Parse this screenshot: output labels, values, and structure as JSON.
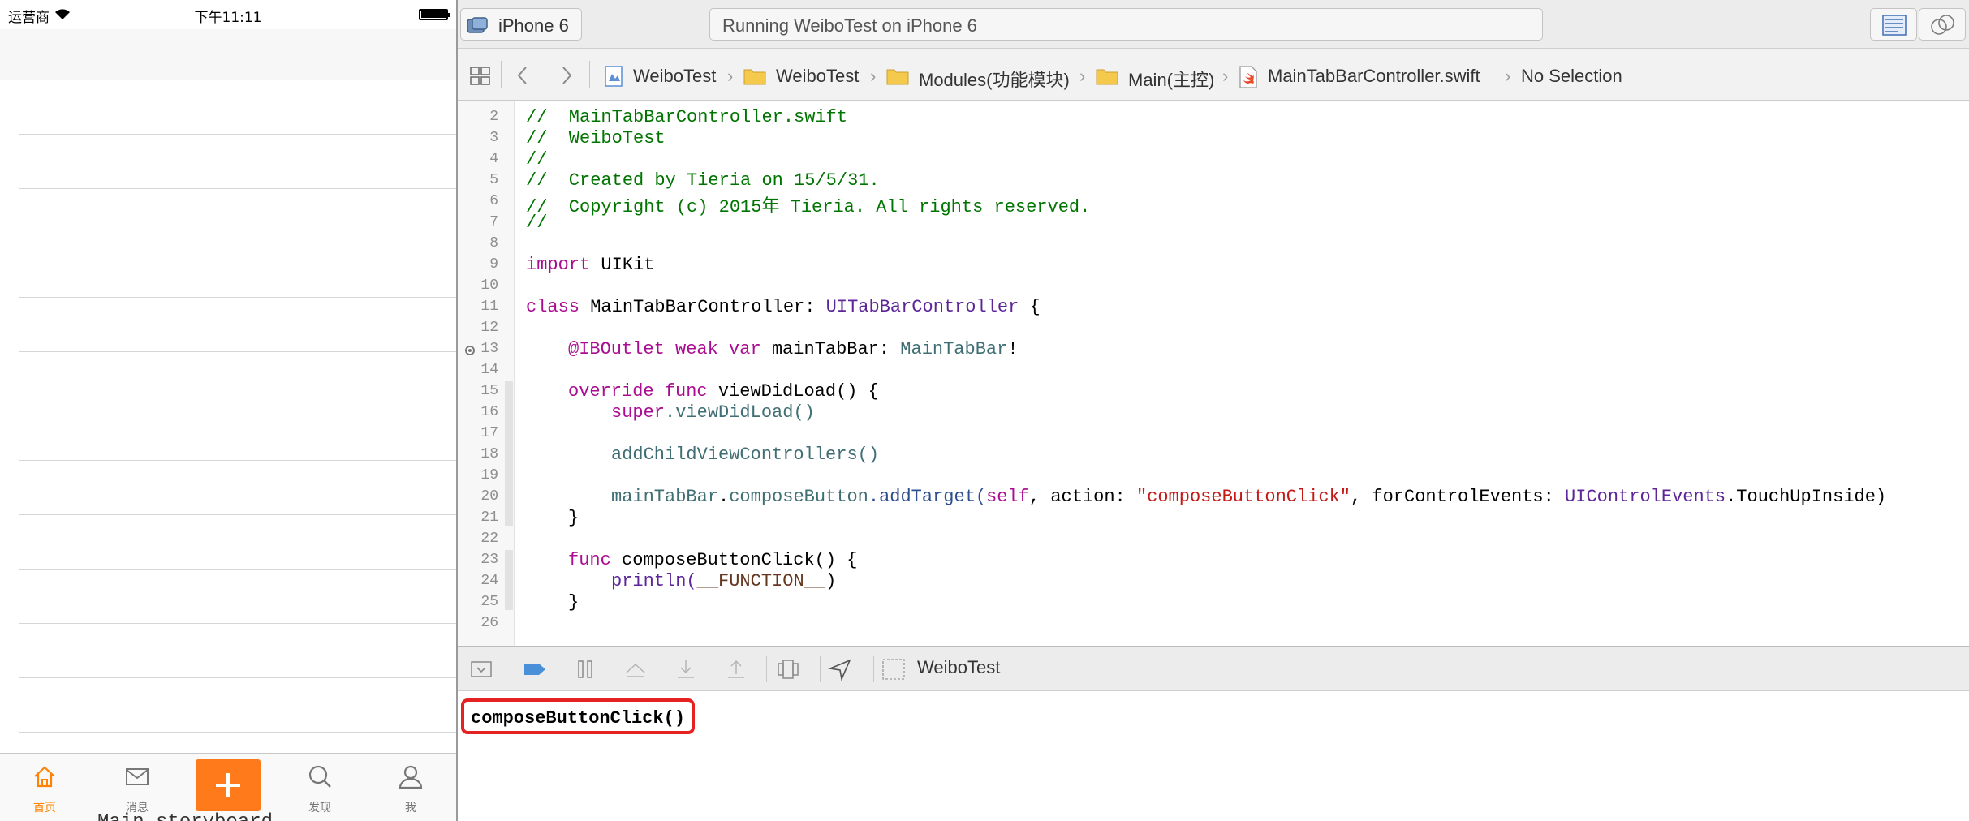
{
  "simulator": {
    "status_bar": {
      "carrier": "运营商",
      "time": "下午11:11"
    },
    "tab_bar": {
      "tabs": [
        {
          "label": "首页",
          "icon": "home-icon",
          "active": true
        },
        {
          "label": "消息",
          "icon": "envelope-icon",
          "active": false
        },
        {
          "label": "",
          "icon": "plus-icon",
          "active": false
        },
        {
          "label": "发现",
          "icon": "search-icon",
          "active": false
        },
        {
          "label": "我",
          "icon": "person-icon",
          "active": false
        }
      ],
      "active_color": "#ff8200",
      "compose_color": "#ff7a1a"
    },
    "clipped_text": "Main.storyboard"
  },
  "toolbar": {
    "scheme_device": "iPhone 6",
    "activity_status": "Running WeiboTest on iPhone 6"
  },
  "jumpbar": {
    "crumbs": [
      "WeiboTest",
      "WeiboTest",
      "Modules(功能模块)",
      "Main(主控)",
      "MainTabBarController.swift",
      "No Selection"
    ]
  },
  "editor": {
    "line_numbers": [
      "2",
      "3",
      "4",
      "5",
      "6",
      "7",
      "8",
      "9",
      "10",
      "11",
      "12",
      "13",
      "14",
      "15",
      "16",
      "17",
      "18",
      "19",
      "20",
      "21",
      "22",
      "23",
      "24",
      "25",
      "26"
    ],
    "lines": {
      "l2": "//  MainTabBarController.swift",
      "l3": "//  WeiboTest",
      "l4": "//",
      "l5": "//  Created by Tieria on 15/5/31.",
      "l6": "//  Copyright (c) 2015年 Tieria. All rights reserved.",
      "l7": "//",
      "l9_kw": "import",
      "l9_rest": " UIKit",
      "l11_kw": "class",
      "l11_name": " MainTabBarController: ",
      "l11_type": "UITabBarController",
      "l11_end": " {",
      "l13_attr": "@IBOutlet",
      "l13_kw": " weak var",
      "l13_name": " mainTabBar: ",
      "l13_type": "MainTabBar",
      "l13_end": "!",
      "l15_kw": "override func",
      "l15_rest": " viewDidLoad() {",
      "l16_kw": "super",
      "l16_rest": ".viewDidLoad()",
      "l18": "addChildViewControllers()",
      "l20_a": "mainTabBar",
      "l20_b": ".",
      "l20_c": "composeButton",
      "l20_d": ".addTarget(",
      "l20_self": "self",
      "l20_e": ", action: ",
      "l20_str": "\"composeButtonClick\"",
      "l20_f": ", forControlEvents: ",
      "l20_type": "UIControlEvents",
      "l20_g": ".TouchUpInside)",
      "l21": "}",
      "l23_kw": "func",
      "l23_rest": " composeButtonClick() {",
      "l24_fn": "println(",
      "l24_macro": "__FUNCTION__",
      "l24_end": ")",
      "l25": "}"
    },
    "colors": {
      "comment": "#007400",
      "keyword": "#aa0d91",
      "type": "#5c2699",
      "project": "#3f6e74",
      "string": "#c41a16",
      "macro": "#643820"
    }
  },
  "debug": {
    "target_name": "WeiboTest",
    "console_output": "composeButtonClick()",
    "highlight_color": "#e52222"
  }
}
